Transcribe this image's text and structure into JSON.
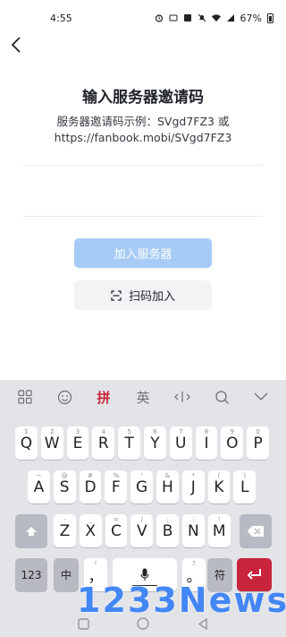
{
  "status": {
    "time": "4:55",
    "battery": "67%"
  },
  "page": {
    "title": "输入服务器邀请码",
    "description_line1": "服务器邀请码示例：SVgd7FZ3 或",
    "description_line2": "https://fanbook.mobi/SVgd7FZ3",
    "input_placeholder": "",
    "join_label": "加入服务器",
    "scan_label": "扫码加入"
  },
  "keyboard": {
    "toolbar": [
      "grid-icon",
      "emoji-icon",
      "拼",
      "英",
      "cursor-icon",
      "search-icon",
      "collapse-icon"
    ],
    "pinyin_label": "拼",
    "english_label": "英",
    "row1": [
      {
        "k": "Q",
        "h": "1"
      },
      {
        "k": "W",
        "h": "2"
      },
      {
        "k": "E",
        "h": "3"
      },
      {
        "k": "R",
        "h": "4"
      },
      {
        "k": "T",
        "h": "5"
      },
      {
        "k": "Y",
        "h": "6"
      },
      {
        "k": "U",
        "h": "7"
      },
      {
        "k": "I",
        "h": "8"
      },
      {
        "k": "O",
        "h": "9"
      },
      {
        "k": "P",
        "h": "0"
      }
    ],
    "row2": [
      {
        "k": "A",
        "h": "~"
      },
      {
        "k": "S",
        "h": "@"
      },
      {
        "k": "D",
        "h": "#"
      },
      {
        "k": "F",
        "h": "%"
      },
      {
        "k": "G",
        "h": "'"
      },
      {
        "k": "H",
        "h": "&"
      },
      {
        "k": "J",
        "h": "*"
      },
      {
        "k": "K",
        "h": "("
      },
      {
        "k": "L",
        "h": ")"
      }
    ],
    "row3": [
      {
        "k": "Z",
        "h": "-"
      },
      {
        "k": "X",
        "h": "_"
      },
      {
        "k": "C",
        "h": "="
      },
      {
        "k": "V",
        "h": "/"
      },
      {
        "k": "B",
        "h": ";"
      },
      {
        "k": "N",
        "h": ":"
      },
      {
        "k": "M",
        "h": "!"
      }
    ],
    "num_label": "123",
    "zh_label": "中",
    "comma_label": "，",
    "period_label": "。",
    "symbol_label": "符",
    "comma_hint": "!",
    "period_hint": "?"
  },
  "watermark": "1233News"
}
